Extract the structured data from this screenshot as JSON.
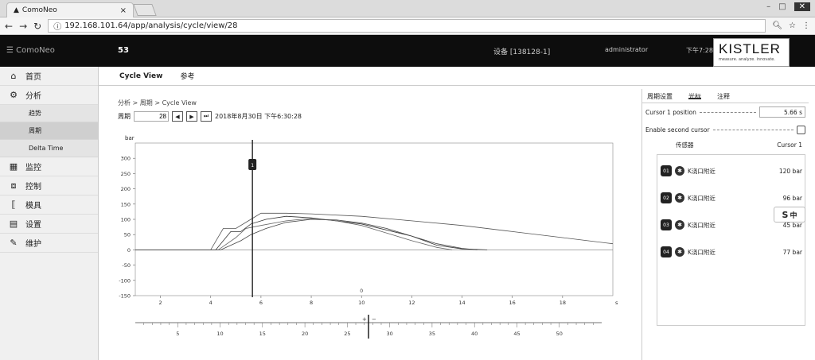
{
  "browser": {
    "tab_title": "ComoNeo",
    "tab_close": "×",
    "url": "192.168.101.64/app/analysis/cycle/view/28",
    "window_controls": [
      "–",
      "□",
      "✕"
    ]
  },
  "appbar": {
    "menu_label": "ComoNeo",
    "cycle_number": "53",
    "device": "设备 [138128-1]",
    "user": "administrator",
    "time": "下午7:28",
    "brand": "KISTLER",
    "tagline": "measure. analyze. innovate."
  },
  "sidebar": {
    "items": [
      {
        "icon": "home-icon",
        "label": "首页"
      },
      {
        "icon": "analysis-icon",
        "label": "分析"
      },
      {
        "sub": "趋势"
      },
      {
        "sub": "周期",
        "active": true
      },
      {
        "sub": "Delta Time"
      },
      {
        "icon": "monitor-icon",
        "label": "监控"
      },
      {
        "icon": "control-icon",
        "label": "控制"
      },
      {
        "icon": "mold-icon",
        "label": "模具"
      },
      {
        "icon": "settings-icon",
        "label": "设置"
      },
      {
        "icon": "maintenance-icon",
        "label": "维护"
      }
    ]
  },
  "main": {
    "tabs": [
      "Cycle View",
      "参考"
    ],
    "breadcrumb": "分析 > 周期 > Cycle View",
    "cycle_label": "周期",
    "cycle_value": "28",
    "timestamp": "2018年8月30日 下午6:30:28",
    "unit": "bar",
    "cursor_label": "1",
    "cursor_x_label": "5.66"
  },
  "right_panel": {
    "tabs": [
      "周期设置",
      "光标",
      "注释"
    ],
    "cursor1_label": "Cursor 1 position",
    "cursor1_value": "5.66 s",
    "second_cursor_label": "Enable second cursor",
    "col_sensor": "传感器",
    "col_cursor": "Cursor 1",
    "sensors": [
      {
        "id": "01",
        "name": "K浇口附近",
        "value": "120 bar"
      },
      {
        "id": "02",
        "name": "K浇口附近",
        "value": "96 bar"
      },
      {
        "id": "03",
        "name": "K浇口附近",
        "value": "45 bar"
      },
      {
        "id": "04",
        "name": "K浇口附近",
        "value": "77 bar"
      }
    ]
  },
  "chart_data": {
    "type": "line",
    "ylabel": "bar",
    "xlabel": "s",
    "ylim": [
      -150,
      350
    ],
    "xlim": [
      1,
      20
    ],
    "yticks": [
      300,
      250,
      200,
      150,
      100,
      50,
      0,
      -50,
      -100,
      -150
    ],
    "xticks": [
      2,
      4,
      6,
      8,
      10,
      12,
      14,
      16,
      18
    ],
    "cursor_x": 5.66,
    "series": [
      {
        "x": [
          1,
          4.0,
          4.5,
          5.0,
          5.5,
          6.0,
          7,
          8,
          10,
          12,
          14,
          16,
          18,
          20
        ],
        "y": [
          0,
          0,
          70,
          70,
          95,
          120,
          120,
          118,
          110,
          95,
          80,
          60,
          40,
          20
        ]
      },
      {
        "x": [
          1,
          4.2,
          4.8,
          5.2,
          5.6,
          6.2,
          7,
          8,
          10,
          12,
          13,
          14,
          15
        ],
        "y": [
          0,
          0,
          60,
          60,
          85,
          100,
          110,
          105,
          85,
          45,
          15,
          3,
          0
        ]
      },
      {
        "x": [
          1,
          4.3,
          5.0,
          5.4,
          6.0,
          7,
          8,
          9,
          10,
          11,
          12,
          13,
          13.6
        ],
        "y": [
          0,
          0,
          40,
          70,
          80,
          95,
          103,
          95,
          80,
          55,
          30,
          8,
          0
        ]
      },
      {
        "x": [
          1,
          4.4,
          5.2,
          5.6,
          6.2,
          7,
          8,
          9,
          10,
          11,
          12,
          13,
          14,
          14.6
        ],
        "y": [
          0,
          0,
          30,
          50,
          70,
          90,
          100,
          98,
          88,
          70,
          45,
          20,
          5,
          0
        ]
      }
    ],
    "overview_ticks": [
      5,
      10,
      15,
      20,
      25,
      30,
      35,
      40,
      45,
      50
    ]
  }
}
